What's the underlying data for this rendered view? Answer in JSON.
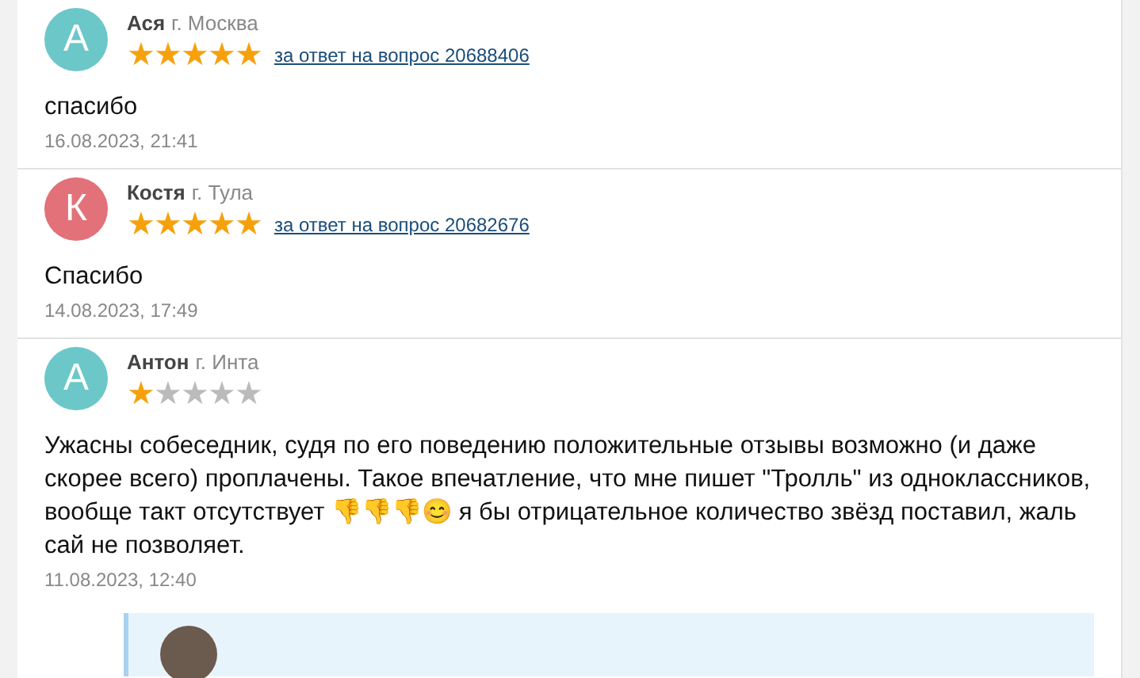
{
  "reviews": [
    {
      "initial": "А",
      "color": "#6cc7c8",
      "name": "Ася",
      "city": "г. Москва",
      "stars": 5,
      "link": "за ответ на вопрос 20688406",
      "text": "спасибо",
      "date": "16.08.2023, 21:41"
    },
    {
      "initial": "К",
      "color": "#e2717a",
      "name": "Костя",
      "city": "г. Тула",
      "stars": 5,
      "link": "за ответ на вопрос 20682676",
      "text": "Спасибо",
      "date": "14.08.2023, 17:49"
    },
    {
      "initial": "А",
      "color": "#6cc7c8",
      "name": "Антон",
      "city": "г. Инта",
      "stars": 1,
      "text": "Ужасны собеседник, судя по его поведению положительные отзывы возможно (и даже скорее всего) проплачены. Такое впечатление, что мне пишет \"Тролль\" из одноклассников, вообще такт отсутствует 👎👎👎😊 я бы отрицательное количество звёзд поставил, жаль сай не позволяет.",
      "date": "11.08.2023, 12:40",
      "has_reply": true
    }
  ]
}
